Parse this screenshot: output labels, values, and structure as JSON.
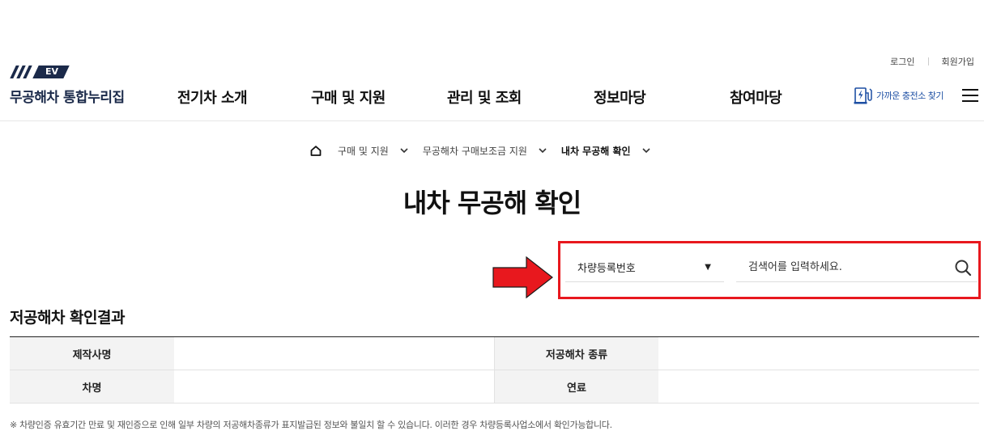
{
  "utility": {
    "login": "로그인",
    "signup": "회원가입"
  },
  "logo": {
    "badge": "EV",
    "name": "무공해차 통합누리집"
  },
  "nav": [
    "전기차 소개",
    "구매 및 지원",
    "관리 및 조회",
    "정보마당",
    "참여마당"
  ],
  "station_finder": {
    "label": "가까운 충전소 찾기",
    "icon": "charging-station-icon"
  },
  "breadcrumb": [
    {
      "label": "구매 및 지원"
    },
    {
      "label": "무공해차 구매보조금 지원"
    },
    {
      "label": "내차 무공해 확인"
    }
  ],
  "page_title": "내차 무공해 확인",
  "search": {
    "select_value": "차량등록번호",
    "placeholder": "검색어를 입력하세요.",
    "highlight_color": "#e8181e"
  },
  "result": {
    "title": "저공해차 확인결과",
    "rows": [
      {
        "label1": "제작사명",
        "value1": "",
        "label2": "저공해차 종류",
        "value2": ""
      },
      {
        "label1": "차명",
        "value1": "",
        "label2": "연료",
        "value2": ""
      }
    ]
  },
  "notice": "※ 차량인증 유효기간 만료 및 재인증으로 인해 일부 차량의 저공해차종류가 표지발급된 정보와 불일치 할 수 있습니다. 이러한 경우 차량등록사업소에서 확인가능합니다.",
  "colors": {
    "brand_navy": "#1b2a4a",
    "link_blue": "#1d4fa3",
    "arrow_red": "#e8181e"
  }
}
